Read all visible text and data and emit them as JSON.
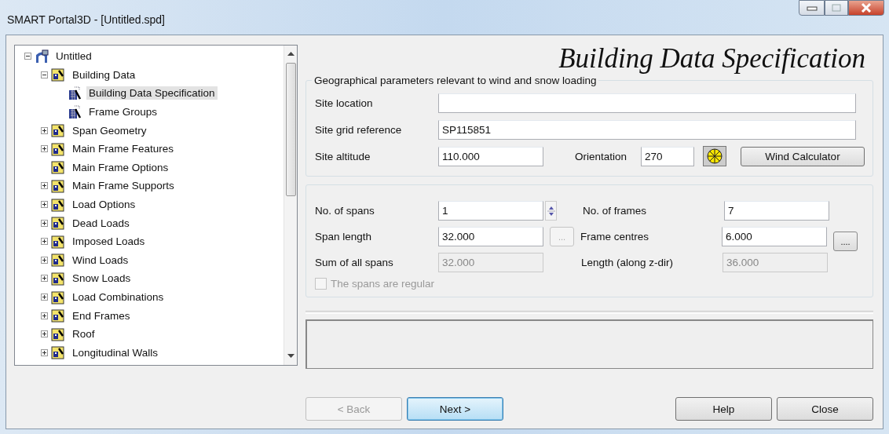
{
  "window": {
    "title": "SMART Portal3D - [Untitled.spd]"
  },
  "tree": [
    {
      "label": "Untitled",
      "kind": "root",
      "has_children": true,
      "expanded": true,
      "selected": false,
      "children": [
        {
          "label": "Building Data",
          "kind": "section",
          "has_children": true,
          "expanded": true,
          "selected": false,
          "children": [
            {
              "label": "Building Data Specification",
              "kind": "page",
              "has_children": false,
              "expanded": false,
              "selected": true
            },
            {
              "label": "Frame Groups",
              "kind": "page",
              "has_children": false,
              "expanded": false,
              "selected": false
            }
          ]
        },
        {
          "label": "Span Geometry",
          "kind": "section",
          "has_children": true,
          "expanded": false,
          "selected": false
        },
        {
          "label": "Main Frame Features",
          "kind": "section",
          "has_children": true,
          "expanded": false,
          "selected": false
        },
        {
          "label": "Main Frame Options",
          "kind": "section",
          "has_children": false,
          "expanded": false,
          "selected": false
        },
        {
          "label": "Main Frame Supports",
          "kind": "section",
          "has_children": true,
          "expanded": false,
          "selected": false
        },
        {
          "label": "Load Options",
          "kind": "section",
          "has_children": true,
          "expanded": false,
          "selected": false
        },
        {
          "label": "Dead Loads",
          "kind": "section",
          "has_children": true,
          "expanded": false,
          "selected": false
        },
        {
          "label": "Imposed Loads",
          "kind": "section",
          "has_children": true,
          "expanded": false,
          "selected": false
        },
        {
          "label": "Wind Loads",
          "kind": "section",
          "has_children": true,
          "expanded": false,
          "selected": false
        },
        {
          "label": "Snow Loads",
          "kind": "section",
          "has_children": true,
          "expanded": false,
          "selected": false
        },
        {
          "label": "Load Combinations",
          "kind": "section",
          "has_children": true,
          "expanded": false,
          "selected": false
        },
        {
          "label": "End Frames",
          "kind": "section",
          "has_children": true,
          "expanded": false,
          "selected": false
        },
        {
          "label": "Roof",
          "kind": "section",
          "has_children": true,
          "expanded": false,
          "selected": false
        },
        {
          "label": "Longitudinal Walls",
          "kind": "section",
          "has_children": true,
          "expanded": false,
          "selected": false
        }
      ]
    }
  ],
  "page_title": "Building Data Specification",
  "geo": {
    "legend": "Geographical parameters relevant to wind and snow loading",
    "site_location": {
      "label": "Site location"
    },
    "grid_reference": {
      "label": "Site grid reference",
      "value": "SP115851"
    },
    "altitude": {
      "label": "Site altitude",
      "value": "110.000"
    },
    "orientation": {
      "label": "Orientation",
      "value": "270"
    },
    "wind_calculator": {
      "label": "Wind Calculator"
    }
  },
  "spans": {
    "no_of_spans": {
      "label": "No. of spans",
      "value": "1"
    },
    "span_length": {
      "label": "Span length",
      "value": "32.000",
      "button_label": "...",
      "button_disabled": true
    },
    "sum_of_spans": {
      "label": "Sum of all spans",
      "value": "32.000",
      "disabled": true
    },
    "no_of_frames": {
      "label": "No. of frames",
      "value": "7"
    },
    "frame_centres": {
      "label": "Frame centres",
      "value": "6.000",
      "button_label": "....",
      "button_disabled": false
    },
    "length": {
      "label": "Length (along z-dir)",
      "value": "36.000",
      "disabled": true
    },
    "regular": {
      "label": "The spans are regular",
      "checked": false,
      "disabled": true
    }
  },
  "buttons": [
    {
      "label": "< Back",
      "disabled": true,
      "default": false
    },
    {
      "label": "Next >",
      "disabled": false,
      "default": true
    },
    {
      "label": "Help",
      "disabled": false,
      "default": false
    },
    {
      "label": "Close",
      "disabled": false,
      "default": false
    }
  ]
}
